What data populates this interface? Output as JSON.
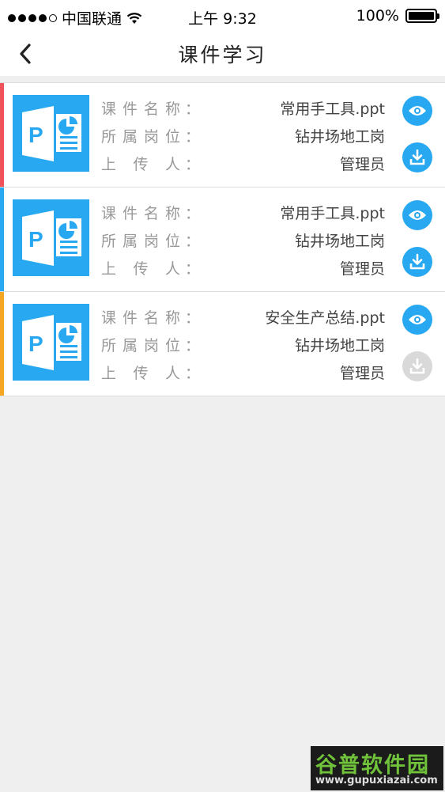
{
  "status_bar": {
    "carrier": "中国联通",
    "time": "上午 9:32",
    "battery": "100%",
    "signal_dots_filled": 4,
    "signal_dots_total": 5,
    "battery_level": 1.0
  },
  "nav": {
    "title": "课件学习",
    "back_icon": "chevron-left-icon"
  },
  "field_labels": {
    "name": "课件名称",
    "post": "所属岗位",
    "uploader": "上传人",
    "colon": "："
  },
  "courses": [
    {
      "name": "常用手工具.ppt",
      "post": "钻井场地工岗",
      "uploader": "管理员",
      "accent": "#f0525a",
      "download_enabled": true
    },
    {
      "name": "常用手工具.ppt",
      "post": "钻井场地工岗",
      "uploader": "管理员",
      "accent": "#28a8f0",
      "download_enabled": true
    },
    {
      "name": "安全生产总结.ppt",
      "post": "钻井场地工岗",
      "uploader": "管理员",
      "accent": "#f5a623",
      "download_enabled": false
    }
  ],
  "colors": {
    "primary": "#28a8f0",
    "disabled": "#d9d9d9"
  },
  "watermark": {
    "title": "谷普软件园",
    "url": "www.gupuxiazai.com"
  }
}
